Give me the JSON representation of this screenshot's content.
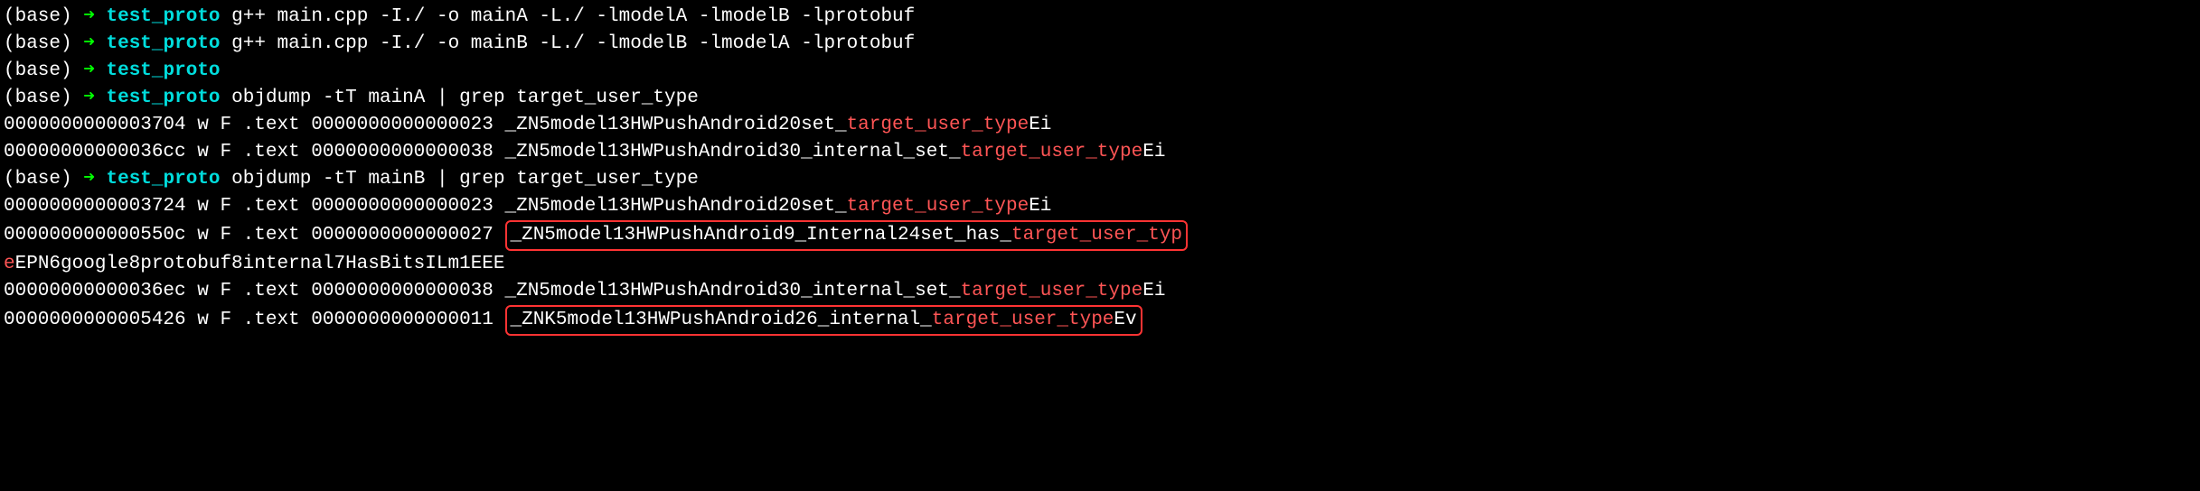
{
  "lines": [
    {
      "type": "prompt",
      "base": "(base)",
      "arrow": "➜",
      "dir": "test_proto",
      "cmd": "g++ main.cpp -I./ -o mainA -L./  -lmodelA -lmodelB -lprotobuf"
    },
    {
      "type": "prompt",
      "base": "(base)",
      "arrow": "➜",
      "dir": "test_proto",
      "cmd": "g++ main.cpp -I./ -o mainB -L./  -lmodelB -lmodelA -lprotobuf"
    },
    {
      "type": "prompt",
      "base": "(base)",
      "arrow": "➜",
      "dir": "test_proto",
      "cmd": ""
    },
    {
      "type": "prompt",
      "base": "(base)",
      "arrow": "➜",
      "dir": "test_proto",
      "cmd": "objdump -tT  mainA | grep target_user_type"
    },
    {
      "type": "output",
      "prefix": "0000000000003704  w    F .text  0000000000000023              _ZN5model13HWPushAndroid20set_",
      "hl": "target_user_type",
      "suffix": "Ei",
      "boxed": false
    },
    {
      "type": "output",
      "prefix": "00000000000036cc  w    F .text  0000000000000038              _ZN5model13HWPushAndroid30_internal_set_",
      "hl": "target_user_type",
      "suffix": "Ei",
      "boxed": false
    },
    {
      "type": "prompt",
      "base": "(base)",
      "arrow": "➜",
      "dir": "test_proto",
      "cmd": "objdump -tT  mainB | grep target_user_type"
    },
    {
      "type": "output",
      "prefix": "0000000000003724  w    F .text  0000000000000023              _ZN5model13HWPushAndroid20set_",
      "hl": "target_user_type",
      "suffix": "Ei",
      "boxed": false
    },
    {
      "type": "output-boxed-split",
      "prefix": "000000000000550c  w    F .text  0000000000000027              ",
      "box_pre": "_ZN5model13HWPushAndroid9_Internal24set_has_",
      "box_hl": "target_user_typ",
      "line2_hl": "e",
      "line2_suffix": "EPN6google8protobuf8internal7HasBitsILm1EEE"
    },
    {
      "type": "output",
      "prefix": "00000000000036ec  w    F .text  0000000000000038              _ZN5model13HWPushAndroid30_internal_set_",
      "hl": "target_user_type",
      "suffix": "Ei",
      "boxed": false
    },
    {
      "type": "output-boxed",
      "prefix": "0000000000005426  w    F .text  0000000000000011              ",
      "box_pre": "_ZNK5model13HWPushAndroid26_internal_",
      "box_hl": "target_user_type",
      "box_suffix": "Ev"
    }
  ]
}
